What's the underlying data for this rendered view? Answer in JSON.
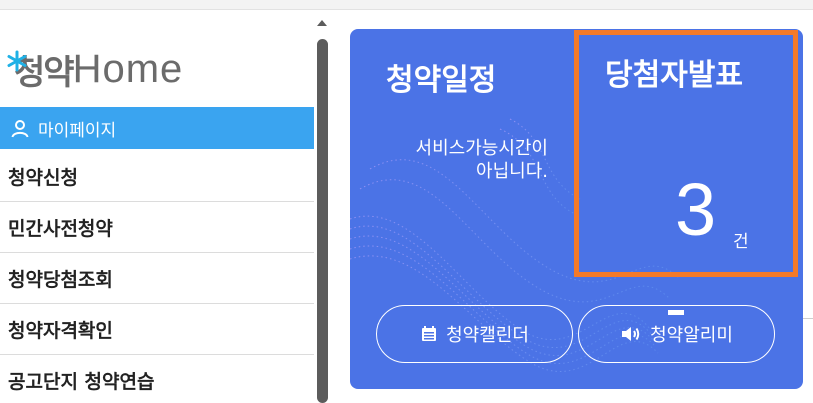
{
  "logo": {
    "text_ko": "청약",
    "text_en": "Home",
    "star_color": "#1fb1e6"
  },
  "sidebar": {
    "mypage_label": "마이페이지",
    "items": [
      {
        "label": "청약신청"
      },
      {
        "label": "민간사전청약"
      },
      {
        "label": "청약당첨조회"
      },
      {
        "label": "청약자격확인"
      },
      {
        "label": "공고단지 청약연습"
      }
    ]
  },
  "card": {
    "schedule_title": "청약일정",
    "schedule_message_line1": "서비스가능시간이",
    "schedule_message_line2": "아닙니다.",
    "winner_title": "당첨자발표",
    "winner_count": "3",
    "winner_unit": "건",
    "calendar_button": "청약캘린더",
    "alarm_button": "청약알리미"
  },
  "colors": {
    "card_bg": "#4b73e6",
    "mypage_bg": "#3aa4f0",
    "highlight_border": "#f47a2a"
  }
}
